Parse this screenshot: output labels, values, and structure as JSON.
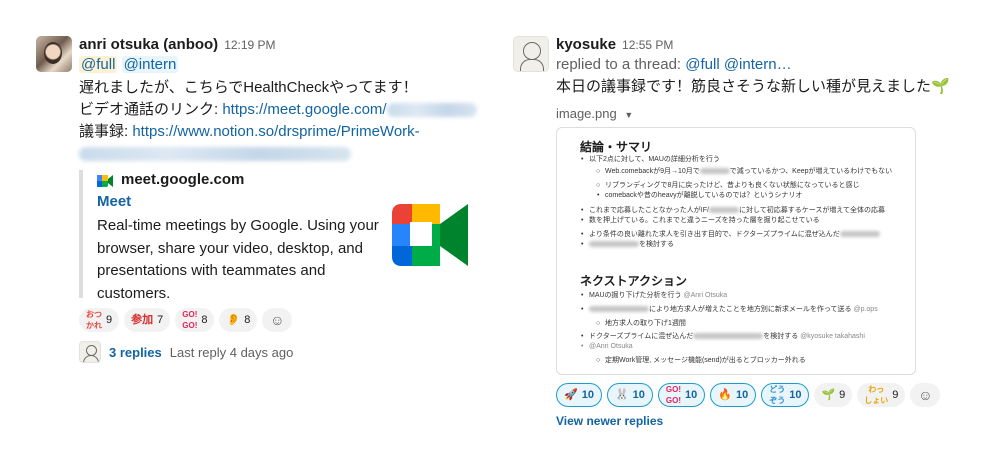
{
  "left": {
    "sender": "anri otsuka (anboo)",
    "time": "12:19 PM",
    "mentions": [
      "@full",
      "@intern"
    ],
    "body_line1": "遅れましたが、こちらでHealthCheckやってます！",
    "video_label": "ビデオ通話のリンク: ",
    "video_link": "https://meet.google.com/",
    "minutes_label": "議事録: ",
    "minutes_link": "https://www.notion.so/drsprime/PrimeWork-",
    "unfurl": {
      "site": "meet.google.com",
      "title": "Meet",
      "desc_lines": [
        "Real-time meetings by Google. Using your",
        "browser, share your video, desktop, and",
        "presentations with teammates and",
        "customers."
      ]
    },
    "reactions": [
      {
        "emoji": "おつ\nかれ",
        "color": "#e8453c",
        "count": "9"
      },
      {
        "emoji": "参加",
        "color": "#d92c2c",
        "count": "7"
      },
      {
        "emoji": "GO!\nGO!",
        "color": "#e0245e",
        "count": "8"
      },
      {
        "emoji": "👂",
        "color": "#f4b400",
        "count": "8"
      }
    ],
    "replies_count": "3 replies",
    "replies_last": "Last reply 4 days ago"
  },
  "right": {
    "sender": "kyosuke",
    "time": "12:55 PM",
    "thread_prefix": "replied to a thread: ",
    "thread_mentions": "@full @intern…",
    "body": "本日の議事録です！筋良さそうな新しい種が見えました",
    "body_emoji": "🌱",
    "image_name": "image.png",
    "doc": {
      "heading1": "結論・サマリ",
      "items1": [
        "以下2点に対して、MAUの詳細分析を行う",
        "Web.comebackが9月→10月で",
        "リブランディングで8月に戻ったけど、昔よりも良くない状態になっていると感じ",
        "comebackや昔のheavyが離脱しているのでは？というシナリオ",
        "これまで応募したことなかった人がIF/",
        "数を押上げている。これまでと違うニーズを持った層を掘り起こせている",
        "より条件の良い離れた求人を引き出す目的で、ドクターズプライムに混ぜ込んだ",
        "を検討する"
      ],
      "item1_b_tail": "で減っているかつ、Keepが増えているわけでもない",
      "item1_e_tail": "に対して初応募するケースが増えて全体の応募",
      "heading2": "ネクストアクション",
      "items2": [
        "MAUの掘り下げた分析を行う",
        "により地方求人が増えたことを地方別に新求メールを作って送る",
        "地方求人の取り下げ1週間",
        "ドクターズプライムに混ぜ込んだ",
        "を検討する",
        "定期Work管理, メッセージ機能(send)が出るとブロッカー外れる"
      ],
      "owner_anri": "@Anri Otsuka",
      "owner_ipops": "@p.ops",
      "owner_kyo": "@kyosuke takahashi"
    },
    "reactions": [
      {
        "emoji": "🚀",
        "color": "#555555",
        "count": "10",
        "on": true
      },
      {
        "emoji": "🐰",
        "color": "#555555",
        "count": "10",
        "on": true
      },
      {
        "emoji": "GO!\nGO!",
        "color": "#e0245e",
        "count": "10",
        "on": true
      },
      {
        "emoji": "🔥",
        "color": "#ff6a00",
        "count": "10",
        "on": true
      },
      {
        "emoji": "どう\nぞう",
        "color": "#2a8ccf",
        "count": "10",
        "on": true
      },
      {
        "emoji": "🌱",
        "color": "#2e7d32",
        "count": "9",
        "on": false
      },
      {
        "emoji": "わっ\nしょい",
        "color": "#e8a400",
        "count": "9",
        "on": false
      }
    ],
    "view_newer": "View newer replies"
  },
  "icons": {
    "add_reaction": "add-reaction-icon",
    "google_meet": "google-meet-icon",
    "caret": "caret-down-icon"
  }
}
